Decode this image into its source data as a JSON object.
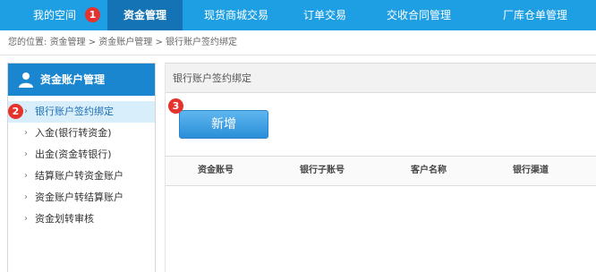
{
  "nav": {
    "items": [
      {
        "label": "我的空间"
      },
      {
        "label": "资金管理"
      },
      {
        "label": "现货商城交易"
      },
      {
        "label": "订单交易"
      },
      {
        "label": "交收合同管理"
      },
      {
        "label": "厂库仓单管理"
      }
    ],
    "active_index": 1
  },
  "badges": [
    "1",
    "2",
    "3"
  ],
  "breadcrumb": {
    "prefix": "您的位置:",
    "path": "资金管理 > 资金账户管理 > 银行账户签约绑定"
  },
  "sidebar": {
    "title": "资金账户管理",
    "items": [
      {
        "label": "银行账户签约绑定"
      },
      {
        "label": "入金(银行转资金)"
      },
      {
        "label": "出金(资金转银行)"
      },
      {
        "label": "结算账户转资金账户"
      },
      {
        "label": "资金账户转结算账户"
      },
      {
        "label": "资金划转审核"
      }
    ]
  },
  "content": {
    "title": "银行账户签约绑定",
    "add_label": "新增",
    "columns": [
      "资金账号",
      "银行子账号",
      "客户名称",
      "银行渠道"
    ]
  },
  "colors": {
    "nav_bg": "#1e9fe3",
    "nav_active": "#1373b5",
    "badge": "#e5322d",
    "side_head": "#1986cf",
    "side_active": "#d9eefb"
  }
}
